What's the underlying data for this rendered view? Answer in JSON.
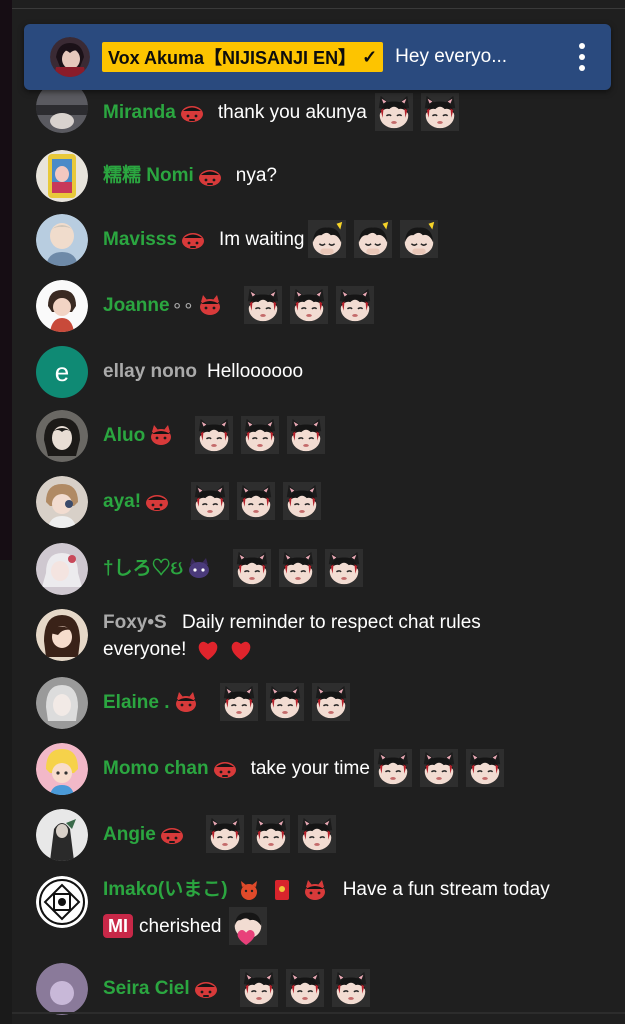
{
  "colors": {
    "member_name": "#2ba640",
    "guest_name": "#aaaaaa",
    "pinned_bg": "#2a4a7e",
    "owner_badge": "#fdc400"
  },
  "pinned": {
    "author": "Vox Akuma【NIJISANJI EN】",
    "check_icon": "✓",
    "message": "Hey everyo...",
    "menu_icon": "kebab-menu-icon"
  },
  "messages": [
    {
      "author": "Miranda",
      "text": "thank you akunya",
      "emotes": 2
    },
    {
      "author": "糯糯 Nomi",
      "text": "nya?",
      "emotes": 0
    },
    {
      "author": "Mavisss",
      "text": "Im waiting",
      "emotes": 3
    },
    {
      "author": "Joanne",
      "text": "",
      "emotes": 3
    },
    {
      "author": "ellay nono",
      "avatar_letter": "e",
      "text": "Helloooooo",
      "emotes": 0
    },
    {
      "author": "Aluo",
      "text": "",
      "emotes": 3
    },
    {
      "author": "aya!",
      "text": "",
      "emotes": 3
    },
    {
      "author": "†しろ♡ઇ",
      "text": "",
      "emotes": 3
    },
    {
      "author": "Foxy•S",
      "text": "Daily reminder to respect chat rules",
      "text2": "everyone!",
      "emotes": 0
    },
    {
      "author": "Elaine .",
      "text": "",
      "emotes": 3
    },
    {
      "author": "Momo chan",
      "text": "take your time",
      "emotes": 3
    },
    {
      "author": "Angie",
      "text": "",
      "emotes": 3
    },
    {
      "author": "Imako(いまこ)",
      "text": "Have a fun stream today",
      "mi_badge": "MI",
      "text2": "cherished",
      "emotes": 1
    },
    {
      "author": "Seira Ciel",
      "text": "",
      "emotes": 3
    }
  ]
}
